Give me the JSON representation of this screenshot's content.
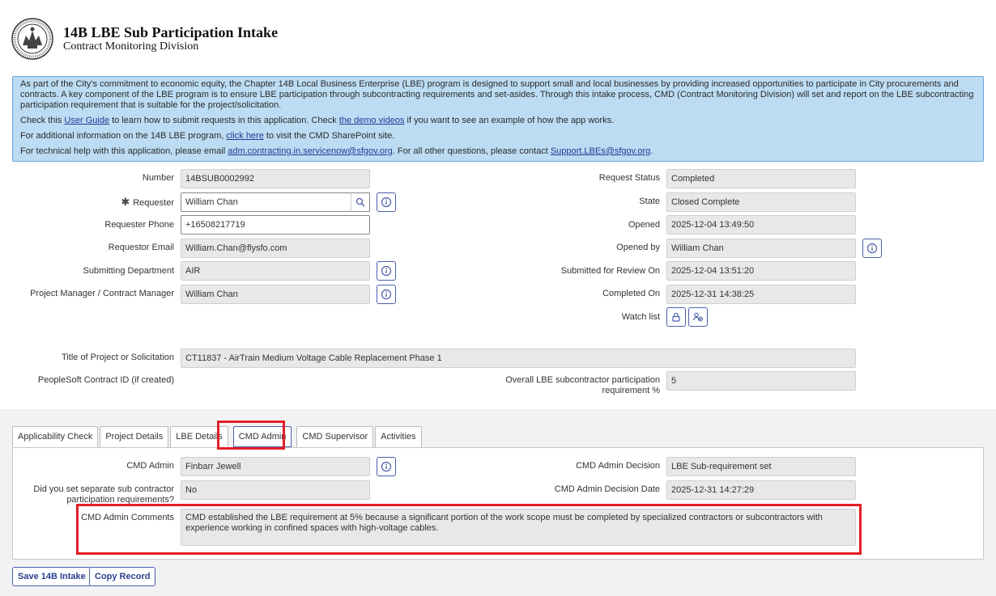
{
  "header": {
    "title": "14B LBE Sub Participation Intake",
    "subtitle": "Contract Monitoring Division"
  },
  "info": {
    "intro": "As part of the City's commitment to economic equity, the Chapter 14B Local Business Enterprise (LBE) program is designed to support small and local businesses by providing increased opportunities to participate in City procurements and contracts. A key component of the LBE program is to ensure LBE participation through subcontracting requirements and set-asides. Through this intake process, CMD (Contract Monitoring Division) will set and report on the LBE subcontracting participation requirement that is suitable for the project/solicitation.",
    "guide_pre": "Check this ",
    "guide_link": "User Guide",
    "guide_mid": " to learn how to submit requests in this application. Check ",
    "demo_link": "the demo videos",
    "guide_post": " if you want to see an example of how the app works.",
    "sharepoint_pre": "For additional information on the 14B LBE program, ",
    "sharepoint_link": "click here",
    "sharepoint_post": " to visit the CMD SharePoint site.",
    "help_pre": "For technical help with this application, please email ",
    "help_email": "adm.contracting.in.servicenow@sfgov.org",
    "help_mid": ". For all other questions, please contact ",
    "support_email": "Support.LBEs@sfgov.org",
    "help_post": "."
  },
  "form": {
    "number_label": "Number",
    "number_value": "14BSUB0002992",
    "requester_star": "✱",
    "requester_label": "Requester",
    "requester_value": "William Chan",
    "requester_phone_label": "Requester Phone",
    "requester_phone_value": "+16508217719",
    "requestor_email_label": "Requestor Email",
    "requestor_email_value": "William.Chan@flysfo.com",
    "submitting_department_label": "Submitting Department",
    "submitting_department_value": "AIR",
    "project_manager_label": "Project Manager / Contract Manager",
    "project_manager_value": "William Chan",
    "request_status_label": "Request Status",
    "request_status_value": "Completed",
    "state_label": "State",
    "state_value": "Closed Complete",
    "opened_label": "Opened",
    "opened_value": "2025-12-04 13:49:50",
    "opened_by_label": "Opened by",
    "opened_by_value": "William Chan",
    "submitted_label": "Submitted for Review On",
    "submitted_value": "2025-12-04 13:51:20",
    "completed_label": "Completed On",
    "completed_value": "2025-12-31 14:38:25",
    "watch_list_label": "Watch list",
    "title_label": "Title of Project or Solicitation",
    "title_value": "CT11837 - AirTrain Medium Voltage Cable Replacement Phase 1",
    "peoplesoft_label": "PeopleSoft Contract ID (if created)",
    "overall_lbe_label_1": "Overall LBE subcontractor participation",
    "overall_lbe_label_2": "requirement %",
    "overall_lbe_value": "5"
  },
  "tabs": [
    {
      "label": "Applicability Check"
    },
    {
      "label": "Project Details"
    },
    {
      "label": "LBE Details"
    },
    {
      "label": "CMD Admin"
    },
    {
      "label": "CMD Supervisor"
    },
    {
      "label": "Activities"
    }
  ],
  "cmd_admin": {
    "admin_label": "CMD Admin",
    "admin_value": "Finbarr Jewell",
    "separate_label_1": "Did you set separate sub contractor",
    "separate_label_2": "participation requirements?",
    "separate_value": "No",
    "decision_label": "CMD Admin Decision",
    "decision_value": "LBE Sub-requirement set",
    "decision_date_label": "CMD Admin Decision Date",
    "decision_date_value": "2025-12-31 14:27:29",
    "comments_label": "CMD Admin Comments",
    "comments_value": "CMD established the LBE requirement at 5% because a significant portion of the work scope must be completed by specialized contractors or subcontractors with experience working in confined spaces with high-voltage cables."
  },
  "buttons": {
    "save": "Save 14B Intake",
    "copy": "Copy Record"
  },
  "colors": {
    "info_bg": "#bcdcf3",
    "accent": "#4a5ea8",
    "highlight": "#e21e26"
  }
}
